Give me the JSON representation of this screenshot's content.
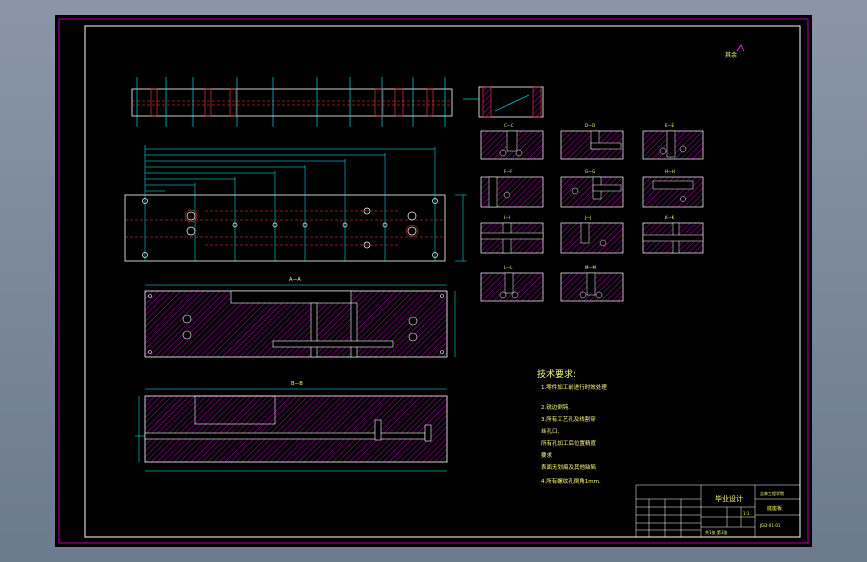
{
  "drawing": {
    "colors": {
      "background_outer": "#7d8a9c",
      "sheet": "#000000",
      "frame": "#b000b0",
      "hatch": "#b000b0",
      "contour": "#ffffff",
      "dimension": "#00ffff",
      "hidden": "#ff4040",
      "text": "#ffff7a",
      "center": "#ff4040"
    },
    "section_labels": [
      "A—A",
      "B—B",
      "C—C",
      "D—D",
      "E—E",
      "F—F",
      "G—G",
      "H—H",
      "I—I",
      "J—J",
      "K—K",
      "L—L",
      "M—M"
    ],
    "view_labels": [
      "A—A",
      "B—B"
    ],
    "tech_requirements": {
      "title": "技术要求:",
      "lines": [
        "1.零件加工前进行时效处理",
        "2.锐边倒钝.",
        "3.所有工艺孔及线割穿",
        "丝孔口.",
        "所有孔加工后位置精度",
        "要求",
        "表面无划痕及其他缺陷",
        "4.所有螺纹孔倒角1mm."
      ]
    },
    "title_block": {
      "main_title": "毕业设计",
      "school": "吉林工程学院",
      "part_name": "底座板",
      "drawing_no": "JGD-01-01",
      "scale": "1:1",
      "sheet_info": "共1张 第1张"
    },
    "corner_note": "其余"
  }
}
